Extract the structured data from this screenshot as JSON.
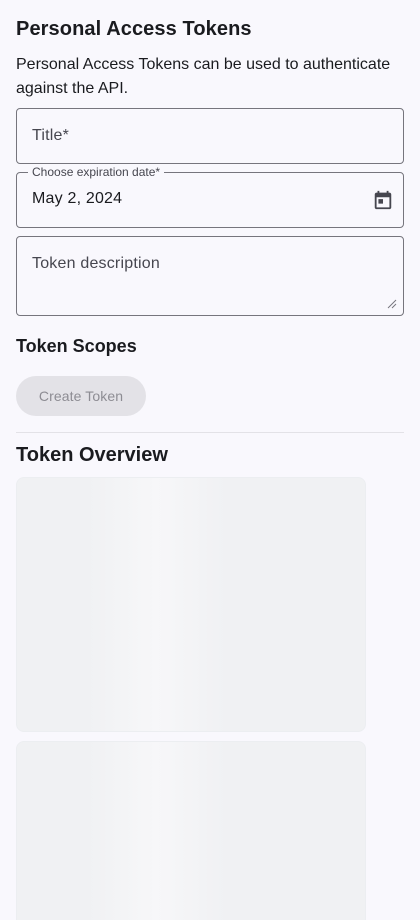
{
  "header": {
    "title": "Personal Access Tokens",
    "description": "Personal Access Tokens can be used to authenticate against the API."
  },
  "form": {
    "title_field": {
      "placeholder": "Title*",
      "value": ""
    },
    "expiration_field": {
      "label": "Choose expiration date*",
      "value": "May 2, 2024",
      "icon": "calendar-icon"
    },
    "description_field": {
      "placeholder": "Token description",
      "value": ""
    }
  },
  "scopes": {
    "title": "Token Scopes"
  },
  "actions": {
    "create_label": "Create Token",
    "create_disabled": true
  },
  "overview": {
    "title": "Token Overview",
    "loading_cards": 2
  },
  "colors": {
    "background": "#f9f8fd",
    "border": "#76757d",
    "disabled_button": "#e3e2e7",
    "disabled_text": "#8d8c93",
    "skeleton": "#f0f1f3"
  }
}
